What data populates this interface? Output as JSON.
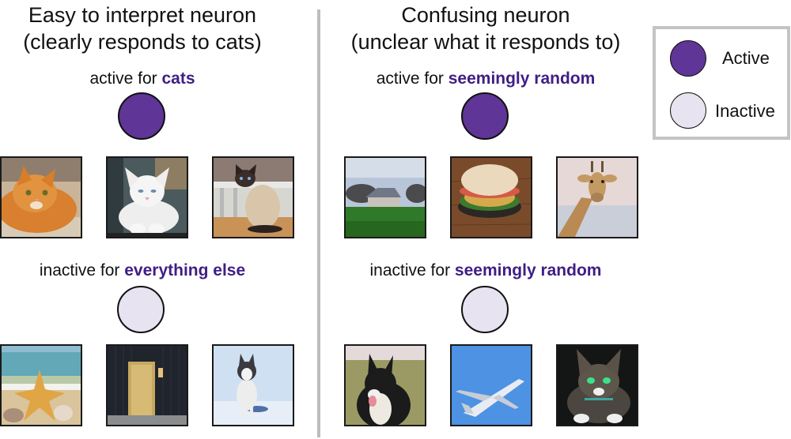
{
  "colors": {
    "active": "#5f3597",
    "inactive": "#e8e3f0",
    "highlight_text": "#3f1e85",
    "divider": "#bdbdbd",
    "legend_border": "#c4c4c4"
  },
  "panels": {
    "left": {
      "title_line1": "Easy to interpret neuron",
      "title_line2": "(clearly responds to cats)",
      "active_prefix": "active for",
      "active_highlight": "cats",
      "active_images": [
        "orange tabby cat",
        "white cat",
        "siamese cat"
      ],
      "inactive_prefix": "inactive for",
      "inactive_highlight": "everything else",
      "inactive_images": [
        "starfish on beach",
        "wooden door",
        "husky in snow"
      ]
    },
    "right": {
      "title_line1": "Confusing neuron",
      "title_line2": "(unclear what it responds to)",
      "active_prefix": "active for",
      "active_highlight": "seemingly random",
      "active_images": [
        "house with lawn",
        "sandwich",
        "giraffe"
      ],
      "inactive_prefix": "inactive for",
      "inactive_highlight": "seemingly random",
      "inactive_images": [
        "border collie dog",
        "airplane",
        "tabby cat"
      ]
    }
  },
  "legend": {
    "active_label": "Active",
    "inactive_label": "Inactive"
  }
}
